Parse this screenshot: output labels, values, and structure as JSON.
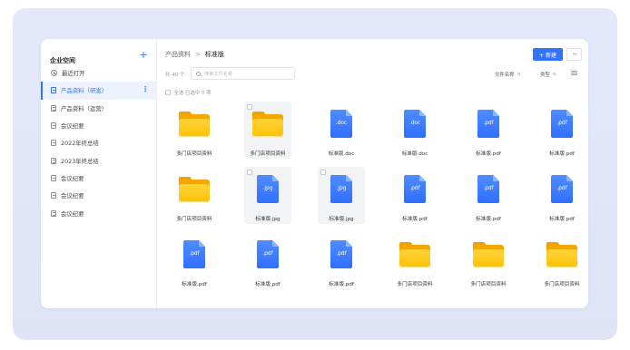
{
  "sidebar": {
    "title": "企业空间",
    "add_icon": "plus-icon",
    "items": [
      {
        "label": "最近打开",
        "icon": "clock-icon",
        "active": false
      },
      {
        "label": "产品资料（研发）",
        "icon": "document-icon",
        "active": true
      },
      {
        "label": "产品资料（运营）",
        "icon": "document-icon",
        "active": false
      },
      {
        "label": "会议纪要",
        "icon": "document-icon",
        "active": false
      },
      {
        "label": "2022年终总结",
        "icon": "document-icon",
        "active": false
      },
      {
        "label": "2023年终总结",
        "icon": "document-icon",
        "active": false
      },
      {
        "label": "会议纪要",
        "icon": "document-icon",
        "active": false
      },
      {
        "label": "会议纪要",
        "icon": "document-icon",
        "active": false
      },
      {
        "label": "会议纪要",
        "icon": "document-icon",
        "active": false
      }
    ],
    "more_glyph": "⋮"
  },
  "breadcrumb": {
    "parent": "产品资料",
    "separator": ">",
    "current": "标准版"
  },
  "toolbar": {
    "new_label": "+ 新建",
    "more_label": "···"
  },
  "filter": {
    "count": "共 40 个",
    "search_placeholder": "搜索文件名称",
    "sort_label": "文件名称",
    "sort_glyph": "⇅",
    "type_label": "类型",
    "type_glyph": "⇅",
    "select_all": "全选  已选中 0 项"
  },
  "files": [
    {
      "kind": "folder",
      "name": "多门店项目资料",
      "ext": "",
      "hover": false
    },
    {
      "kind": "folder",
      "name": "多门店项目资料",
      "ext": "",
      "hover": true
    },
    {
      "kind": "file",
      "name": "标准版.doc",
      "ext": ".doc",
      "hover": false
    },
    {
      "kind": "file",
      "name": "标准版.doc",
      "ext": ".doc",
      "hover": false
    },
    {
      "kind": "file",
      "name": "标准版.pdf",
      "ext": ".pdf",
      "hover": false
    },
    {
      "kind": "file",
      "name": "标准版.pdf",
      "ext": ".pdf",
      "hover": false
    },
    {
      "kind": "folder",
      "name": "多门店项目资料",
      "ext": "",
      "hover": false
    },
    {
      "kind": "file",
      "name": "标准版.jpg",
      "ext": ".jpg",
      "hover": true
    },
    {
      "kind": "file",
      "name": "标准版.jpg",
      "ext": ".jpg",
      "hover": true
    },
    {
      "kind": "file",
      "name": "标准版.pdf",
      "ext": ".pdf",
      "hover": false
    },
    {
      "kind": "file",
      "name": "标准版.pdf",
      "ext": ".pdf",
      "hover": false
    },
    {
      "kind": "file",
      "name": "标准版.pdf",
      "ext": ".pdf",
      "hover": false
    },
    {
      "kind": "file",
      "name": "标准版.pdf",
      "ext": ".pdf",
      "hover": false
    },
    {
      "kind": "file",
      "name": "标准版.pdf",
      "ext": ".pdf",
      "hover": false
    },
    {
      "kind": "file",
      "name": "标准版.pdf",
      "ext": ".pdf",
      "hover": false
    },
    {
      "kind": "folder",
      "name": "多门店项目资料",
      "ext": "",
      "hover": false
    },
    {
      "kind": "folder",
      "name": "多门店项目资料",
      "ext": "",
      "hover": false
    },
    {
      "kind": "folder",
      "name": "多门店项目资料",
      "ext": "",
      "hover": false
    }
  ],
  "colors": {
    "accent": "#2f73ff",
    "folder": "#ffc107",
    "file": "#3a7bff",
    "active_bg": "#ecf3ff"
  }
}
